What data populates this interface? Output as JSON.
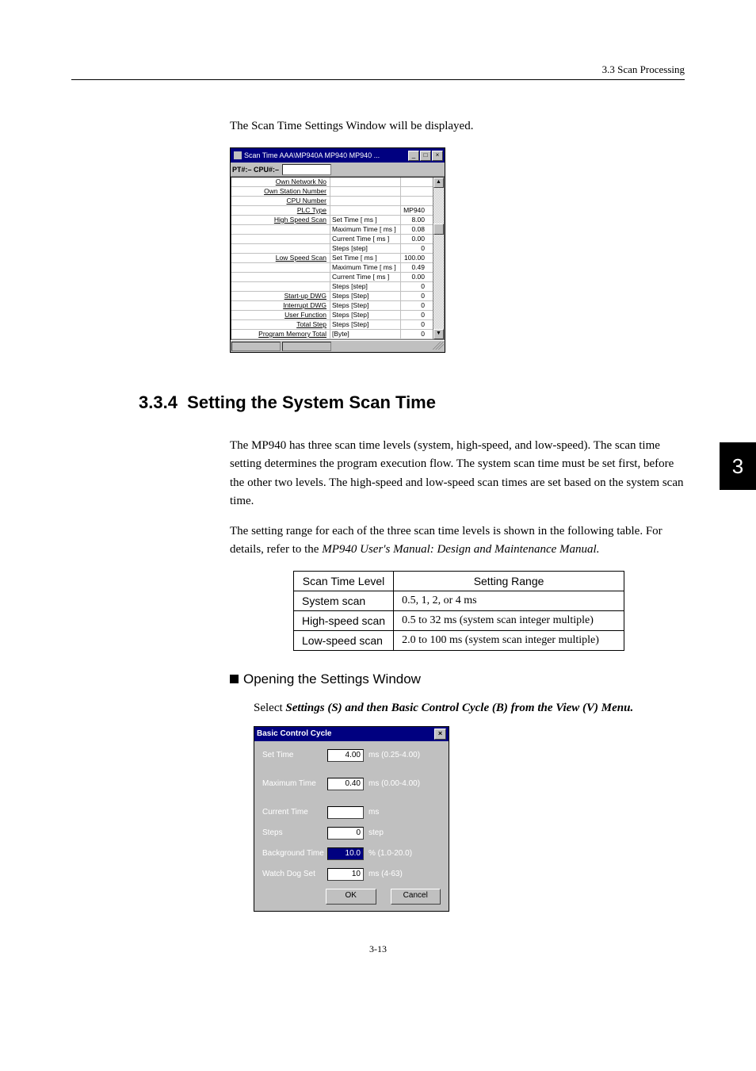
{
  "header": {
    "section_ref": "3.3  Scan Processing"
  },
  "side_tab": "3",
  "intro_line": "The Scan Time Settings Window will be displayed.",
  "scan_window": {
    "title": "Scan Time    AAA\\MP940A  MP940  MP940        ...",
    "subbar": "PT#:– CPU#:–",
    "rows": [
      {
        "c1": "Own Network No",
        "c2": "",
        "c3": ""
      },
      {
        "c1": "Own Station Number",
        "c2": "",
        "c3": ""
      },
      {
        "c1": "CPU Number",
        "c2": "",
        "c3": ""
      },
      {
        "c1": "PLC Type",
        "c2": "",
        "c3": "MP940"
      },
      {
        "c1": "High Speed Scan",
        "c2": "Set Time  [ ms ]",
        "c3": "8.00"
      },
      {
        "c1": "",
        "c2": "Maximum Time  [ ms ]",
        "c3": "0.08"
      },
      {
        "c1": "",
        "c2": "Current Time [ ms ]",
        "c3": "0.00"
      },
      {
        "c1": "",
        "c2": "Steps      [step]",
        "c3": "0"
      },
      {
        "c1": "Low Speed Scan",
        "c2": "Set Time  [ ms ]",
        "c3": "100.00"
      },
      {
        "c1": "",
        "c2": "Maximum Time  [ ms ]",
        "c3": "0.49"
      },
      {
        "c1": "",
        "c2": "Current Time [ ms ]",
        "c3": "0.00"
      },
      {
        "c1": "",
        "c2": "Steps      [step]",
        "c3": "0"
      },
      {
        "c1": "Start-up DWG",
        "c2": "Steps      [Step]",
        "c3": "0"
      },
      {
        "c1": "Interrupt DWG",
        "c2": "Steps      [Step]",
        "c3": "0"
      },
      {
        "c1": "User Function",
        "c2": "Steps      [Step]",
        "c3": "0"
      },
      {
        "c1": "Total Step",
        "c2": "Steps      [Step]",
        "c3": "0"
      },
      {
        "c1": "Program Memory Total",
        "c2": "[Byte]",
        "c3": "0"
      }
    ]
  },
  "section": {
    "number": "3.3.4",
    "title": "Setting the System Scan Time",
    "para1": "The MP940 has three scan time levels (system, high-speed, and low-speed). The scan time setting determines the program execution flow. The system scan time must be set first, before the other two levels. The high-speed and low-speed scan times are set based on the system scan time.",
    "para2a": "The setting range for each of the three scan time levels is shown in the following table. For details, refer to the ",
    "para2b": "MP940 User's Manual: Design and Maintenance Manual.",
    "table": {
      "headers": [
        "Scan Time Level",
        "Setting Range"
      ],
      "rows": [
        [
          "System scan",
          "0.5, 1, 2, or 4 ms"
        ],
        [
          "High-speed scan",
          "0.5 to 32 ms (system scan integer multiple)"
        ],
        [
          "Low-speed scan",
          "2.0 to 100 ms (system scan integer multiple)"
        ]
      ]
    }
  },
  "subhead": "Opening the Settings Window",
  "instruction": {
    "lead": "Select ",
    "bold": "Settings (S) and then Basic Control Cycle (B) from the View (V) Menu."
  },
  "dialog": {
    "title": "Basic Control Cycle",
    "fields": [
      {
        "label": "Set Time",
        "value": "4.00",
        "unit": "ms",
        "range": "(0.25-4.00)",
        "sel": false
      },
      {
        "label": "Maximum Time",
        "value": "0.40",
        "unit": "ms",
        "range": "(0.00-4.00)",
        "sel": false
      },
      {
        "label": "Current Time",
        "value": "",
        "unit": "ms",
        "range": "",
        "sel": false
      },
      {
        "label": "Steps",
        "value": "0",
        "unit": "step",
        "range": "",
        "sel": false
      },
      {
        "label": "Background Time",
        "value": "10.0",
        "unit": "%",
        "range": "(1.0-20.0)",
        "sel": true
      },
      {
        "label": "Watch Dog Set",
        "value": "10",
        "unit": "ms",
        "range": "(4-63)",
        "sel": false
      }
    ],
    "ok": "OK",
    "cancel": "Cancel"
  },
  "footer": "3-13"
}
